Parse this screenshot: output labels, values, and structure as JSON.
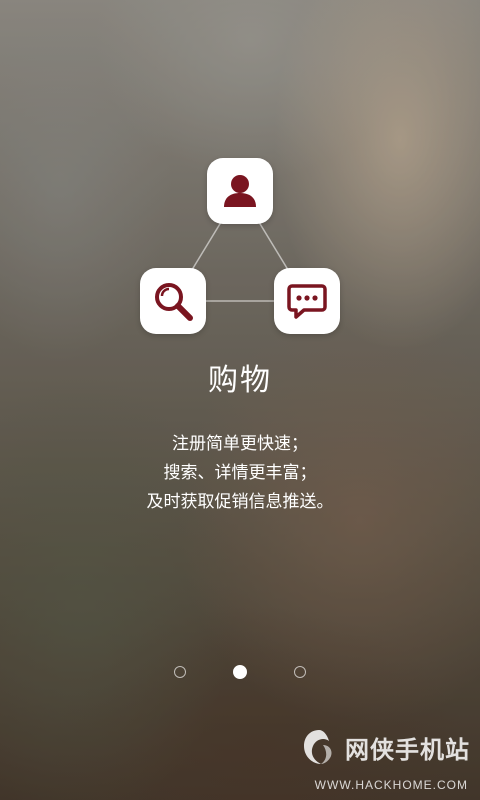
{
  "colors": {
    "accent": "#7a1520",
    "tile_background": "#ffffff",
    "text": "#ffffff"
  },
  "diagram": {
    "icons": [
      "user-icon",
      "search-icon",
      "chat-icon"
    ]
  },
  "feature": {
    "title": "购物",
    "lines": [
      "注册简单更快速；",
      "搜索、详情更丰富；",
      "及时获取促销信息推送。"
    ]
  },
  "pager": {
    "total": 3,
    "active_index": 2
  },
  "watermark": {
    "brand": "网侠手机站",
    "url": "WWW.HACKHOME.COM"
  }
}
